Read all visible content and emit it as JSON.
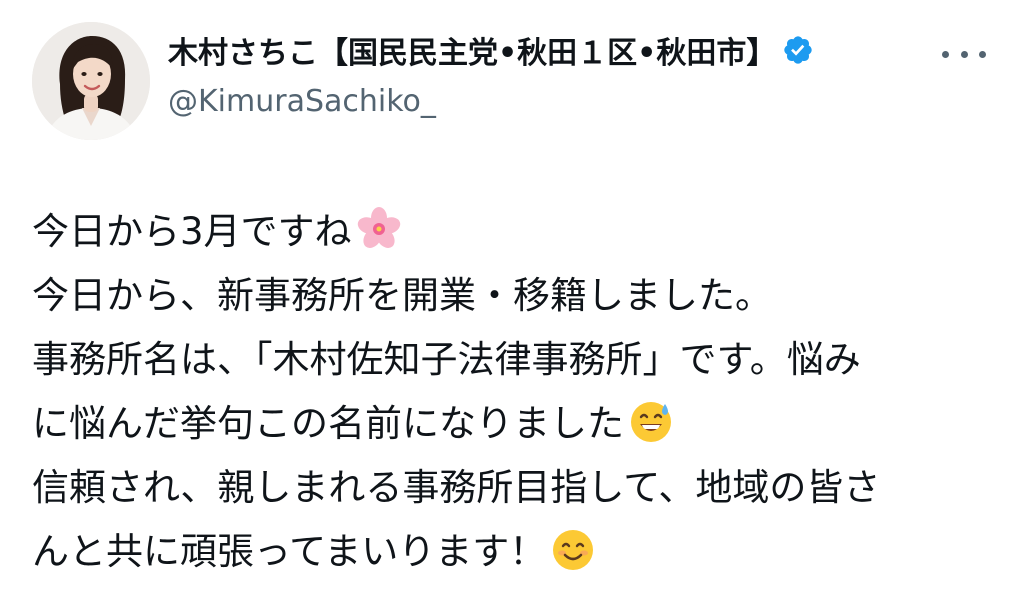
{
  "author": {
    "display_name": "木村さちこ【国民民主党•秋田１区•秋田市】",
    "handle": "@KimuraSachiko_",
    "verified": true,
    "verified_icon": "verified-badge-icon",
    "avatar": "profile-photo"
  },
  "header": {
    "more_icon": "more-options-icon"
  },
  "tweet": {
    "lines": [
      {
        "text": "今日から3月ですね",
        "emoji": "cherry-blossom-emoji"
      },
      {
        "text": "今日から、新事務所を開業・移籍しました。"
      },
      {
        "text": "事務所名は、「木村佐知子法律事務所」です。悩み"
      },
      {
        "text": "に悩んだ挙句この名前になりました",
        "emoji": "grinning-sweat-emoji"
      },
      {
        "text": "信頼され、親しまれる事務所目指して、地域の皆さ"
      },
      {
        "text": "んと共に頑張ってまいります！",
        "emoji": "smiling-face-emoji"
      }
    ]
  },
  "colors": {
    "text_primary": "#0f1419",
    "text_secondary": "#536471",
    "verified_blue": "#1d9bf0",
    "background": "#ffffff"
  }
}
